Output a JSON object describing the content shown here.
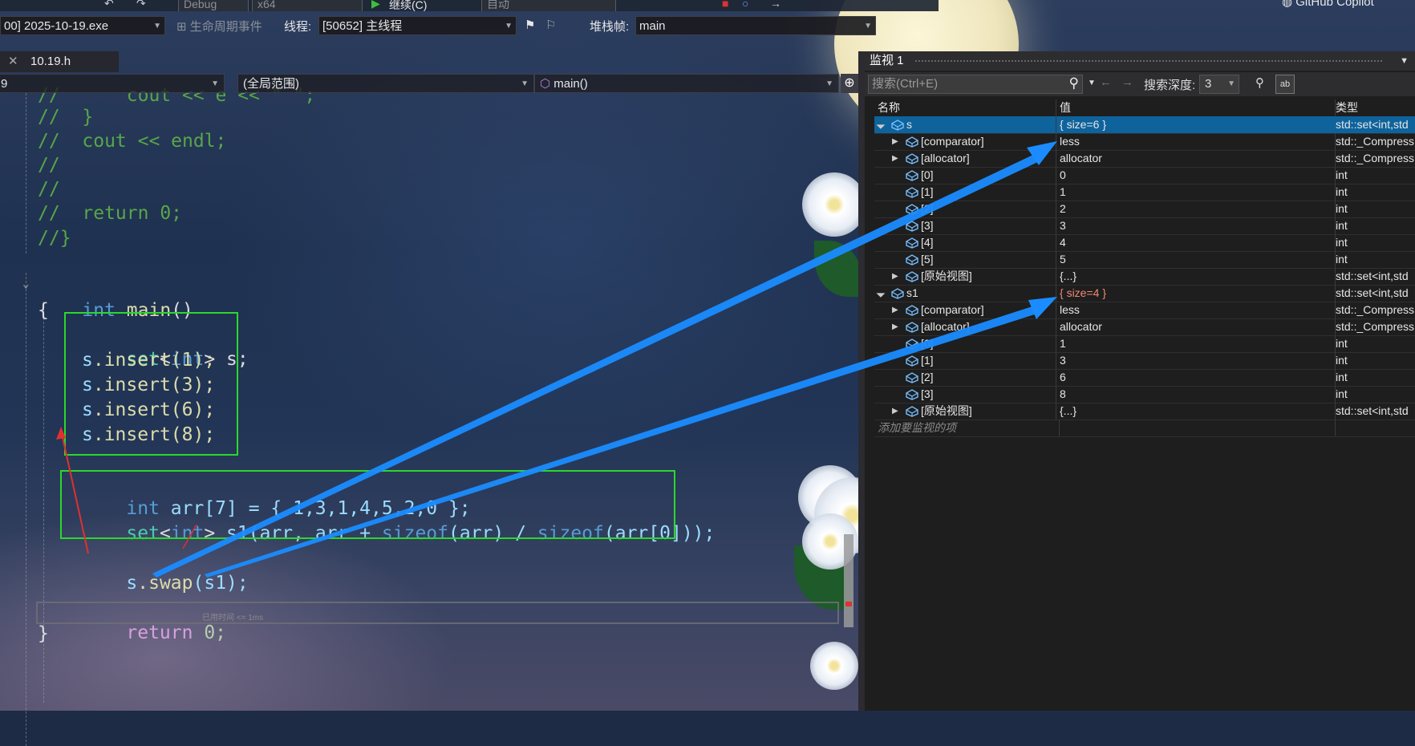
{
  "toolbar": {
    "config": "Debug",
    "platform": "x64",
    "continue_label": "继续(C)",
    "auto": "自动",
    "copilot": "GitHub Copilot",
    "process": "00] 2025-10-19.exe",
    "lifecycle": "生命周期事件",
    "thread_label": "线程:",
    "thread_value": "[50652] 主线程",
    "stack_label": "堆栈帧:",
    "stack_value": "main"
  },
  "editor": {
    "tab_name": "10.19.h",
    "nav_left": "9",
    "nav_scope": "(全局范围)",
    "nav_func": "main()",
    "elapsed_hint": "已用时间 <= 1ms",
    "code": {
      "c1": "//      cout << e << \" \";",
      "c2": "//  }",
      "c3": "//  cout << endl;",
      "c4": "//",
      "c5": "//",
      "c6": "//  return 0;",
      "c7": "//}",
      "m_kw": "int",
      "m_fn": "main",
      "m_p": "()",
      "brace_open": "{",
      "brace_close": "}",
      "l1_a": "set",
      "l1_b": "<",
      "l1_c": "int",
      "l1_d": "> s;",
      "l2": ".insert(1);",
      "l3": ".insert(3);",
      "l4": ".insert(6);",
      "l5": ".insert(8);",
      "s_id": "s",
      "arr_kw": "int",
      "arr_rest": " arr[7] = { 1,3,1,4,5,2,0 };",
      "s1_set": "set",
      "s1_lt": "<",
      "s1_int": "int",
      "s1_gt": "> ",
      "s1_name": "s1",
      "s1_rest1": "(arr, arr + ",
      "s1_sizeof1": "sizeof",
      "s1_rest2": "(arr) / ",
      "s1_sizeof2": "sizeof",
      "s1_rest3": "(arr[0]));",
      "swap_s": "s",
      "swap_fn": ".swap",
      "swap_rest": "(s1);",
      "ret_kw": "return",
      "ret_rest": " 0;"
    }
  },
  "watch": {
    "title": "监视 1",
    "search_placeholder": "搜索(Ctrl+E)",
    "depth_label": "搜索深度:",
    "depth_value": "3",
    "col_name": "名称",
    "col_value": "值",
    "col_type": "类型",
    "add_item": "添加要监视的项",
    "rows": [
      {
        "name": "s",
        "value": "{ size=6 }",
        "type": "std::set<int,std"
      },
      {
        "name": "[comparator]",
        "value": "less",
        "type": "std::_Compress"
      },
      {
        "name": "[allocator]",
        "value": "allocator",
        "type": "std::_Compress"
      },
      {
        "name": "[0]",
        "value": "0",
        "type": "int"
      },
      {
        "name": "[1]",
        "value": "1",
        "type": "int"
      },
      {
        "name": "[2]",
        "value": "2",
        "type": "int"
      },
      {
        "name": "[3]",
        "value": "3",
        "type": "int"
      },
      {
        "name": "[4]",
        "value": "4",
        "type": "int"
      },
      {
        "name": "[5]",
        "value": "5",
        "type": "int"
      },
      {
        "name": "[原始视图]",
        "value": "{...}",
        "type": "std::set<int,std"
      },
      {
        "name": "s1",
        "value": "{ size=4 }",
        "type": "std::set<int,std"
      },
      {
        "name": "[comparator]",
        "value": "less",
        "type": "std::_Compress"
      },
      {
        "name": "[allocator]",
        "value": "allocator",
        "type": "std::_Compress"
      },
      {
        "name": "[0]",
        "value": "1",
        "type": "int"
      },
      {
        "name": "[1]",
        "value": "3",
        "type": "int"
      },
      {
        "name": "[2]",
        "value": "6",
        "type": "int"
      },
      {
        "name": "[3]",
        "value": "8",
        "type": "int"
      },
      {
        "name": "[原始视图]",
        "value": "{...}",
        "type": "std::set<int,std"
      }
    ]
  },
  "colors": {
    "accent_blue": "#0e639c",
    "annotation_box": "#2bd82b",
    "annotation_arrow": "#1a8cff",
    "annotation_red": "#e03030"
  }
}
